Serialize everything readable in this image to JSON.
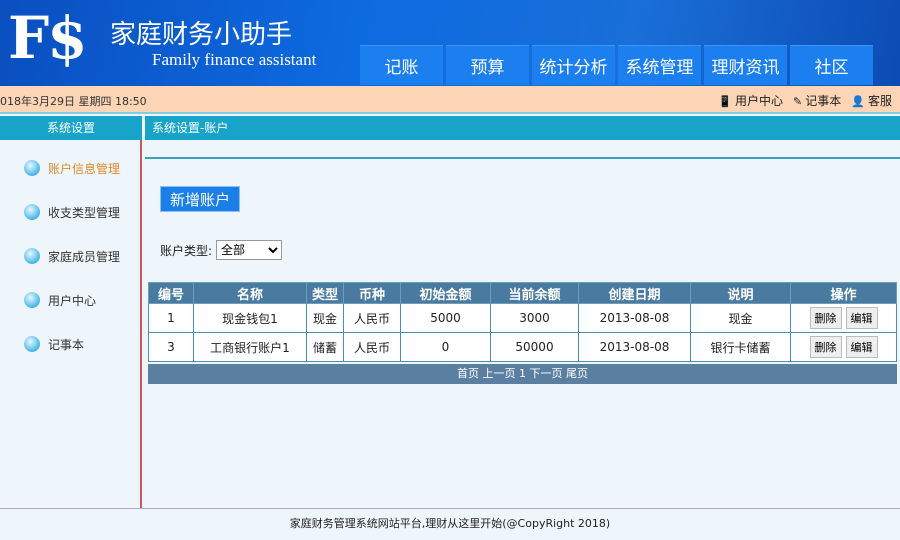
{
  "header": {
    "logo": "F$",
    "title": "家庭财务小助手",
    "subtitle": "Family finance assistant",
    "nav": [
      "记账",
      "预算",
      "统计分析",
      "系统管理",
      "理财资讯",
      "社区"
    ]
  },
  "bar": {
    "datetime": "018年3月29日 星期四 18:50",
    "links": [
      "用户中心",
      "记事本",
      "客服"
    ]
  },
  "sidebar": {
    "title": "系统设置",
    "items": [
      "账户信息管理",
      "收支类型管理",
      "家庭成员管理",
      "用户中心",
      "记事本"
    ]
  },
  "main": {
    "breadcrumb": "系统设置-账户",
    "new_button": "新增账户",
    "filter_label": "账户类型:",
    "filter_value": "全部",
    "columns": [
      "编号",
      "名称",
      "类型",
      "币种",
      "初始金额",
      "当前余额",
      "创建日期",
      "说明",
      "操作"
    ],
    "rows": [
      [
        "1",
        "现金钱包1",
        "现金",
        "人民币",
        "5000",
        "3000",
        "2013-08-08",
        "现金"
      ],
      [
        "3",
        "工商银行账户1",
        "储蓄",
        "人民币",
        "0",
        "50000",
        "2013-08-08",
        "银行卡储蓄"
      ]
    ],
    "delete_label": "删除",
    "edit_label": "编辑",
    "pager": {
      "first": "首页",
      "prev": "上一页",
      "current": "1",
      "next": "下一页",
      "last": "尾页"
    }
  },
  "footer": "家庭财务管理系统网站平台,理财从这里开始(@CopyRight 2018)"
}
